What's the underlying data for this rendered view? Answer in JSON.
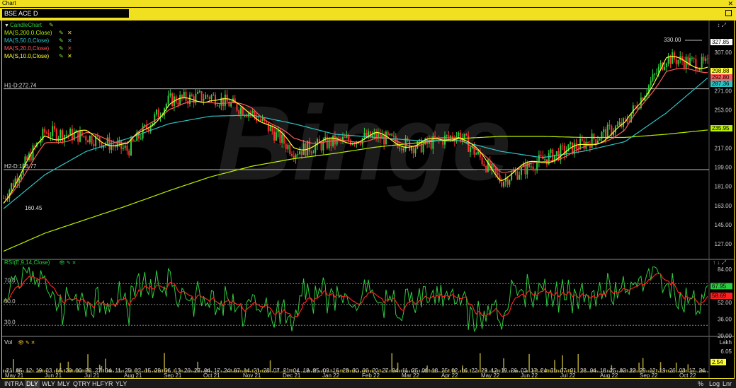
{
  "window": {
    "title": "Chart"
  },
  "symbol": {
    "name": "BSE ACE D"
  },
  "indicators": [
    {
      "label": "CandleChart",
      "color": "#2ecc40"
    },
    {
      "label": "MA(S,200.0,Close)",
      "color": "#b8f000"
    },
    {
      "label": "MA(S,50.0,Close)",
      "color": "#2ec4c4"
    },
    {
      "label": "MA(S,20.0,Close)",
      "color": "#ff5a5a"
    },
    {
      "label": "MA(S,10.0,Close)",
      "color": "#ffff30"
    }
  ],
  "rsi_label": "RSI(E,9,14,Close)",
  "vol_label": "Vol",
  "watermark": "Binge",
  "hlines": [
    {
      "label": "H1-D:272.74",
      "value": 272.74
    },
    {
      "label": "H2-D:196.77",
      "value": 196.77
    }
  ],
  "annotations": {
    "low": "160.45",
    "high": "330.00"
  },
  "price_axis": [
    "307.00",
    "289.00",
    "271.00",
    "253.00",
    "235.00",
    "217.00",
    "199.00",
    "181.00",
    "163.00",
    "145.00",
    "127.00"
  ],
  "price_tags": [
    {
      "text": "327.85",
      "bg": "#ffffff",
      "fg": "#000000"
    },
    {
      "text": "298.88",
      "bg": "#ffff30",
      "fg": "#000000"
    },
    {
      "text": "292.80",
      "bg": "#ff5a5a",
      "fg": "#000000"
    },
    {
      "text": "287.36",
      "bg": "#2ec4c4",
      "fg": "#000000"
    },
    {
      "text": "235.95",
      "bg": "#b8f000",
      "fg": "#000000"
    }
  ],
  "rsi_axis": [
    "84.00",
    "52.00",
    "36.00",
    "20.00"
  ],
  "rsi_levels": [
    "70.0",
    "50.0",
    "30.0"
  ],
  "rsi_tags": [
    {
      "text": "67.95",
      "bg": "#2ecc40"
    },
    {
      "text": "58.69",
      "bg": "#ff2020"
    }
  ],
  "vol_axis": {
    "unit": "Lakh",
    "top": "6.05",
    "tag": "2.54"
  },
  "date_axis": {
    "days": [
      "21",
      "05",
      "12",
      "19",
      "03",
      "16",
      "30",
      "06",
      "20",
      "27",
      "04",
      "11",
      "25",
      "02",
      "15",
      "29",
      "06",
      "13",
      "20",
      "27",
      "04",
      "17",
      "24",
      "07",
      "14",
      "21",
      "28",
      "07",
      "21",
      "04",
      "18",
      "25",
      "09",
      "16",
      "23",
      "30",
      "06",
      "20",
      "27",
      "04",
      "11",
      "25",
      "01",
      "18",
      "25",
      "02",
      "16",
      "22",
      "29",
      "12",
      "19",
      "26",
      "03",
      "17",
      "24",
      "31",
      "07",
      "21",
      "28",
      "04",
      "18",
      "25",
      "02",
      "22",
      "29",
      "12",
      "19",
      "26",
      "03",
      "17",
      "24"
    ],
    "months": [
      "May 21",
      "Jun 21",
      "Jul 21",
      "Aug 21",
      "Sep 21",
      "Oct 21",
      "Nov 21",
      "Dec 21",
      "Jan 22",
      "Feb 22",
      "Mar 22",
      "Apr 22",
      "May 22",
      "Jun 22",
      "Jul 22",
      "Aug 22",
      "Sep 22",
      "Oct 22"
    ]
  },
  "timeframes": [
    "INTRA",
    "DLY",
    "WLY",
    "MLY",
    "QTRY",
    "HLFYR",
    "YLY"
  ],
  "selected_timeframe": "DLY",
  "bottom_right": [
    "%",
    "Log",
    "Lnr"
  ],
  "chart_data": {
    "type": "line",
    "title": "BSE ACE D",
    "x": [
      "May 21",
      "Jun 21",
      "Jul 21",
      "Aug 21",
      "Sep 21",
      "Oct 21",
      "Nov 21",
      "Dec 21",
      "Jan 22",
      "Feb 22",
      "Mar 22",
      "Apr 22",
      "May 22",
      "Jun 22",
      "Jul 22",
      "Aug 22",
      "Sep 22",
      "Oct 22"
    ],
    "series": [
      {
        "name": "CandleChart",
        "values": [
          170,
          232,
          228,
          215,
          262,
          266,
          250,
          214,
          223,
          228,
          218,
          230,
          186,
          206,
          221,
          240,
          302,
          295
        ]
      },
      {
        "name": "MA(S,200.0,Close)",
        "values": [
          120,
          137,
          150,
          163,
          177,
          190,
          200,
          207,
          212,
          218,
          222,
          226,
          228,
          228,
          227,
          227,
          230,
          234
        ]
      },
      {
        "name": "MA(S,50.0,Close)",
        "values": [
          160,
          192,
          214,
          226,
          240,
          247,
          248,
          240,
          230,
          227,
          224,
          224,
          214,
          208,
          214,
          223,
          250,
          283
        ]
      },
      {
        "name": "MA(S,20.0,Close)",
        "values": [
          165,
          220,
          230,
          222,
          255,
          262,
          255,
          225,
          222,
          226,
          220,
          229,
          195,
          203,
          216,
          233,
          290,
          290
        ]
      },
      {
        "name": "MA(S,10.0,Close)",
        "values": [
          168,
          228,
          230,
          218,
          258,
          265,
          252,
          218,
          223,
          228,
          219,
          230,
          190,
          205,
          218,
          237,
          300,
          295
        ]
      }
    ],
    "rsi": {
      "label": "RSI(E,9,14,Close)",
      "last": 67.95,
      "signal_last": 58.69,
      "levels": [
        70,
        50,
        30
      ]
    },
    "volume": {
      "unit": "Lakh",
      "last": 2.54,
      "max": 6.05
    },
    "ylim": [
      115,
      333
    ],
    "last": 327.85,
    "high": 330.0,
    "low": 160.45
  }
}
